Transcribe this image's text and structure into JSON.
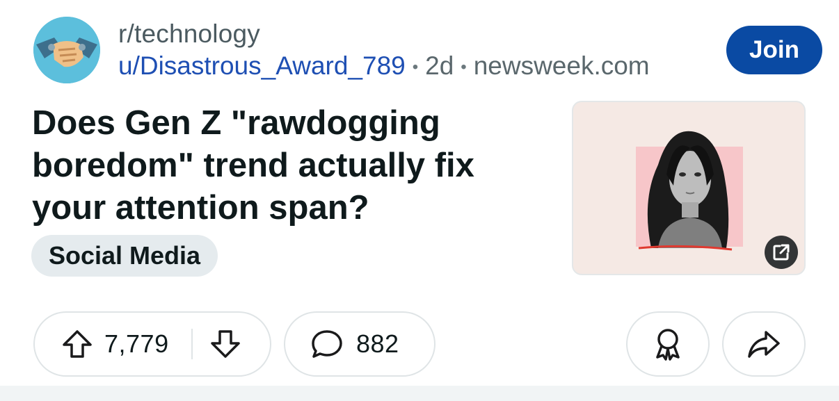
{
  "post": {
    "subreddit": "r/technology",
    "author": "u/Disastrous_Award_789",
    "separator": "•",
    "age": "2d",
    "domain": "newsweek.com",
    "join_label": "Join",
    "title": "Does Gen Z \"rawdogging boredom\" trend actually fix your attention span?",
    "flair": "Social Media"
  },
  "actions": {
    "upvotes": "7,779",
    "comments": "882"
  },
  "icons": {
    "avatar": "handshake-icon",
    "external": "external-link-icon",
    "upvote": "arrow-up-icon",
    "downvote": "arrow-down-icon",
    "comment": "comment-bubble-icon",
    "award": "award-icon",
    "share": "share-arrow-icon"
  },
  "colors": {
    "join_bg": "#0a4aa3",
    "author_link": "#1e4fb3",
    "flair_bg": "#e5ebee",
    "thumbnail_bg": "#f5e9e4"
  }
}
